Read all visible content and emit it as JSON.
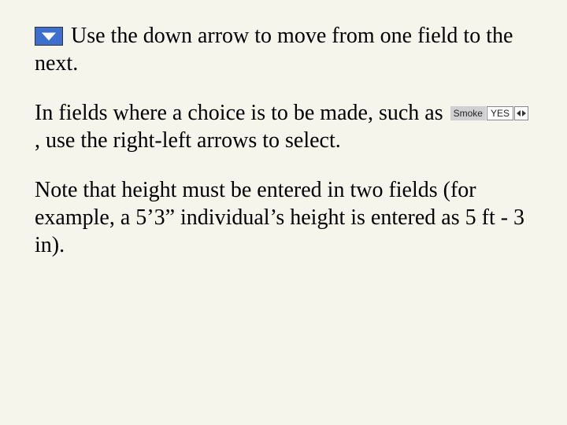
{
  "para1": {
    "text_a": "Use the down arrow to move from one field to the next."
  },
  "para2": {
    "text_a": "In fields where a choice is to be made, such as ",
    "widget_label": "Smoke",
    "widget_value": "YES",
    "text_b": ", use the right-left arrows to select."
  },
  "para3": {
    "text_a": "Note that height must be entered in two fields (for example, a 5’3” individual’s height is entered as 5 ft - 3 in)."
  }
}
